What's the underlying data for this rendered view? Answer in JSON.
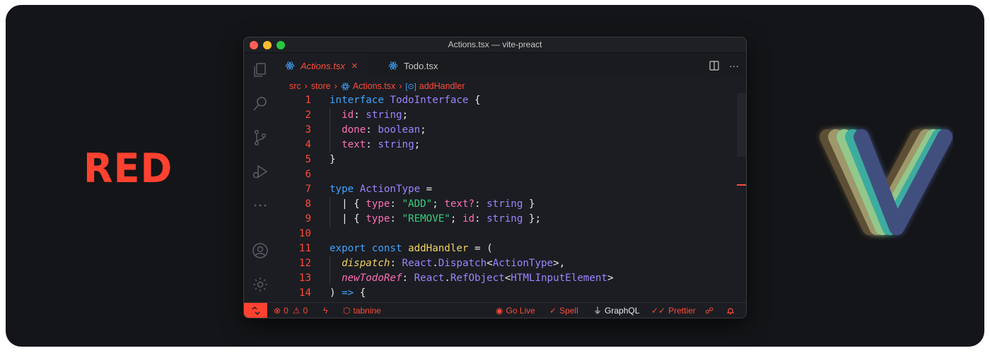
{
  "brand": {
    "wordmark": "RED",
    "accent": "#ff4130"
  },
  "window": {
    "title": "Actions.tsx — vite-preact"
  },
  "tabs": [
    {
      "label": "Actions.tsx",
      "active": true,
      "icon": "react-icon"
    },
    {
      "label": "Todo.tsx",
      "active": false,
      "icon": "react-icon"
    }
  ],
  "tab_actions": {
    "split": "split-editor-icon",
    "more": "···"
  },
  "breadcrumb": {
    "parts": [
      "src",
      "store",
      "Actions.tsx",
      "addHandler"
    ]
  },
  "code": {
    "line_numbers": [
      "1",
      "2",
      "3",
      "4",
      "5",
      "6",
      "7",
      "8",
      "9",
      "10",
      "11",
      "12",
      "13",
      "14"
    ],
    "lines": [
      [
        [
          "kw",
          "interface"
        ],
        [
          "pn",
          " "
        ],
        [
          "ty",
          "TodoInterface"
        ],
        [
          "pn",
          " {"
        ]
      ],
      [
        [
          "pn",
          "  "
        ],
        [
          "pr",
          "id"
        ],
        [
          "pn",
          ": "
        ],
        [
          "ty",
          "string"
        ],
        [
          "pn",
          ";"
        ]
      ],
      [
        [
          "pn",
          "  "
        ],
        [
          "pr",
          "done"
        ],
        [
          "pn",
          ": "
        ],
        [
          "ty",
          "boolean"
        ],
        [
          "pn",
          ";"
        ]
      ],
      [
        [
          "pn",
          "  "
        ],
        [
          "pr",
          "text"
        ],
        [
          "pn",
          ": "
        ],
        [
          "ty",
          "string"
        ],
        [
          "pn",
          ";"
        ]
      ],
      [
        [
          "pn",
          "}"
        ]
      ],
      [],
      [
        [
          "kw",
          "type"
        ],
        [
          "pn",
          " "
        ],
        [
          "ty",
          "ActionType"
        ],
        [
          "pn",
          " ="
        ]
      ],
      [
        [
          "pn",
          "  | { "
        ],
        [
          "pr",
          "type"
        ],
        [
          "pn",
          ": "
        ],
        [
          "str",
          "\"ADD\""
        ],
        [
          "pn",
          "; "
        ],
        [
          "pr",
          "text?"
        ],
        [
          "pn",
          ": "
        ],
        [
          "ty",
          "string"
        ],
        [
          "pn",
          " }"
        ]
      ],
      [
        [
          "pn",
          "  | { "
        ],
        [
          "pr",
          "type"
        ],
        [
          "pn",
          ": "
        ],
        [
          "str",
          "\"REMOVE\""
        ],
        [
          "pn",
          "; "
        ],
        [
          "pr",
          "id"
        ],
        [
          "pn",
          ": "
        ],
        [
          "ty",
          "string"
        ],
        [
          "pn",
          " };"
        ]
      ],
      [],
      [
        [
          "kw",
          "export"
        ],
        [
          "pn",
          " "
        ],
        [
          "kw",
          "const"
        ],
        [
          "pn",
          " "
        ],
        [
          "fn",
          "addHandler"
        ],
        [
          "pn",
          " = ("
        ]
      ],
      [
        [
          "pn",
          "  "
        ],
        [
          "par",
          "dispatch"
        ],
        [
          "pn",
          ": "
        ],
        [
          "tg",
          "React"
        ],
        [
          "pn",
          "."
        ],
        [
          "tg",
          "Dispatch"
        ],
        [
          "pn",
          "<"
        ],
        [
          "tg",
          "ActionType"
        ],
        [
          "pn",
          ">,"
        ]
      ],
      [
        [
          "pn",
          "  "
        ],
        [
          "par2",
          "newTodoRef"
        ],
        [
          "pn",
          ": "
        ],
        [
          "tg",
          "React"
        ],
        [
          "pn",
          "."
        ],
        [
          "tg",
          "RefObject"
        ],
        [
          "pn",
          "<"
        ],
        [
          "tg",
          "HTMLInputElement"
        ],
        [
          "pn",
          ">"
        ]
      ],
      [
        [
          "pn",
          ") "
        ],
        [
          "kw",
          "=>"
        ],
        [
          "pn",
          " {"
        ]
      ]
    ]
  },
  "status": {
    "errors": "0",
    "warnings": "0",
    "tabnine": "tabnine",
    "go_live": "Go Live",
    "spell": "Spell",
    "graphql": "GraphQL",
    "prettier": "Prettier"
  },
  "colors": {
    "background": "#141518",
    "editor": "#1b1d22",
    "keyword": "#3fa3ff",
    "type": "#9d84ff",
    "property": "#ff6fb5",
    "string": "#33d17a",
    "function": "#f2d35b"
  }
}
